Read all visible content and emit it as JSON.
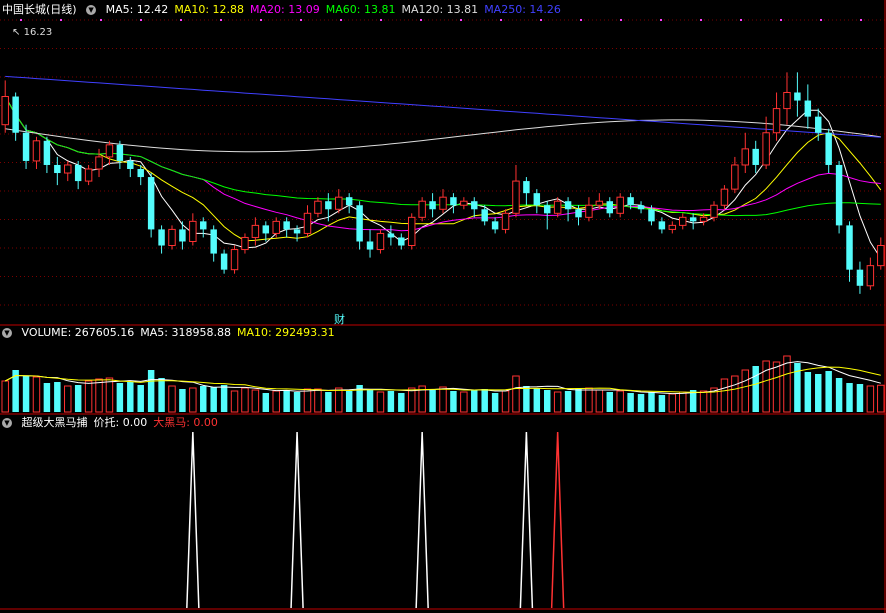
{
  "price_panel": {
    "title": "中国长城(日线)",
    "ma_labels": [
      {
        "text": "MA5: 12.42",
        "color": "#ffffff"
      },
      {
        "text": "MA10: 12.88",
        "color": "#ffff00"
      },
      {
        "text": "MA20: 13.09",
        "color": "#ff00ff"
      },
      {
        "text": "MA60: 13.81",
        "color": "#00ff00"
      },
      {
        "text": "MA120: 13.81",
        "color": "#dddddd"
      },
      {
        "text": "MA250: 14.26",
        "color": "#4040ff"
      }
    ],
    "high_marker": "16.23",
    "finance_marker": "财",
    "colors": {
      "up": "#ff3232",
      "down": "#54fcfc"
    }
  },
  "volume_panel": {
    "labels": [
      {
        "text": "VOLUME: 267605.16",
        "color": "#ffffff"
      },
      {
        "text": "MA5: 318958.88",
        "color": "#ffffff"
      },
      {
        "text": "MA10: 292493.31",
        "color": "#ffff00"
      }
    ]
  },
  "indicator_panel": {
    "labels": [
      {
        "text": "超级大黑马捕",
        "color": "#ffffff"
      },
      {
        "text": "价托: 0.00",
        "color": "#ffffff"
      },
      {
        "text": "大黑马: 0.00",
        "color": "#ff3232"
      }
    ]
  },
  "chart_data": {
    "type": "candlestick",
    "price_range": [
      9.4,
      16.8
    ],
    "candles": [
      [
        14.2,
        14.9,
        14.0,
        15.3
      ],
      [
        14.9,
        14.0,
        13.8,
        15.0
      ],
      [
        14.0,
        13.3,
        13.1,
        14.2
      ],
      [
        13.3,
        13.8,
        13.1,
        13.9
      ],
      [
        13.8,
        13.2,
        13.0,
        13.9
      ],
      [
        13.2,
        13.0,
        12.7,
        13.4
      ],
      [
        13.0,
        13.2,
        12.8,
        13.3
      ],
      [
        13.2,
        12.8,
        12.6,
        13.3
      ],
      [
        12.8,
        13.1,
        12.7,
        13.2
      ],
      [
        13.1,
        13.4,
        12.9,
        13.6
      ],
      [
        13.4,
        13.7,
        13.2,
        13.8
      ],
      [
        13.7,
        13.3,
        13.1,
        13.8
      ],
      [
        13.3,
        13.1,
        12.9,
        13.4
      ],
      [
        13.1,
        12.9,
        12.7,
        13.2
      ],
      [
        12.9,
        11.6,
        11.4,
        13.0
      ],
      [
        11.6,
        11.2,
        11.0,
        11.7
      ],
      [
        11.2,
        11.6,
        11.1,
        11.7
      ],
      [
        11.6,
        11.3,
        11.1,
        11.8
      ],
      [
        11.3,
        11.8,
        11.2,
        12.0
      ],
      [
        11.8,
        11.6,
        11.4,
        11.9
      ],
      [
        11.6,
        11.0,
        10.8,
        11.7
      ],
      [
        11.0,
        10.6,
        10.5,
        11.1
      ],
      [
        10.6,
        11.1,
        10.5,
        11.2
      ],
      [
        11.1,
        11.4,
        11.0,
        11.5
      ],
      [
        11.4,
        11.7,
        11.2,
        11.9
      ],
      [
        11.7,
        11.5,
        11.3,
        11.8
      ],
      [
        11.5,
        11.8,
        11.4,
        11.9
      ],
      [
        11.8,
        11.6,
        11.4,
        11.9
      ],
      [
        11.6,
        11.5,
        11.3,
        11.7
      ],
      [
        11.5,
        12.0,
        11.4,
        12.2
      ],
      [
        12.0,
        12.3,
        11.9,
        12.4
      ],
      [
        12.3,
        12.1,
        11.8,
        12.5
      ],
      [
        12.1,
        12.4,
        12.0,
        12.6
      ],
      [
        12.4,
        12.2,
        12.0,
        12.5
      ],
      [
        12.2,
        11.3,
        11.1,
        12.3
      ],
      [
        11.3,
        11.1,
        10.9,
        11.6
      ],
      [
        11.1,
        11.5,
        11.0,
        11.6
      ],
      [
        11.5,
        11.4,
        11.2,
        11.7
      ],
      [
        11.4,
        11.2,
        11.1,
        11.5
      ],
      [
        11.2,
        11.9,
        11.1,
        12.0
      ],
      [
        11.9,
        12.3,
        11.8,
        12.4
      ],
      [
        12.3,
        12.1,
        11.9,
        12.5
      ],
      [
        12.1,
        12.4,
        12.0,
        12.6
      ],
      [
        12.4,
        12.2,
        12.0,
        12.5
      ],
      [
        12.2,
        12.3,
        12.1,
        12.4
      ],
      [
        12.3,
        12.1,
        11.9,
        12.4
      ],
      [
        12.1,
        11.8,
        11.7,
        12.2
      ],
      [
        11.8,
        11.6,
        11.5,
        11.9
      ],
      [
        11.6,
        12.0,
        11.5,
        12.1
      ],
      [
        12.0,
        12.8,
        11.9,
        13.2
      ],
      [
        12.8,
        12.5,
        12.2,
        12.9
      ],
      [
        12.5,
        12.2,
        12.0,
        12.6
      ],
      [
        12.2,
        12.0,
        11.6,
        12.3
      ],
      [
        12.0,
        12.3,
        11.9,
        12.4
      ],
      [
        12.3,
        12.1,
        11.8,
        12.4
      ],
      [
        12.1,
        11.9,
        11.7,
        12.2
      ],
      [
        11.9,
        12.2,
        11.8,
        12.4
      ],
      [
        12.2,
        12.3,
        12.1,
        12.5
      ],
      [
        12.3,
        12.0,
        11.9,
        12.4
      ],
      [
        12.0,
        12.4,
        11.9,
        12.5
      ],
      [
        12.4,
        12.2,
        12.1,
        12.5
      ],
      [
        12.2,
        12.1,
        12.0,
        12.3
      ],
      [
        12.1,
        11.8,
        11.7,
        12.2
      ],
      [
        11.8,
        11.6,
        11.5,
        11.9
      ],
      [
        11.6,
        11.7,
        11.5,
        11.8
      ],
      [
        11.7,
        11.9,
        11.6,
        12.0
      ],
      [
        11.9,
        11.8,
        11.6,
        12.0
      ],
      [
        11.8,
        11.9,
        11.7,
        12.0
      ],
      [
        11.9,
        12.2,
        11.8,
        12.3
      ],
      [
        12.2,
        12.6,
        12.1,
        12.7
      ],
      [
        12.6,
        13.2,
        12.5,
        13.4
      ],
      [
        13.2,
        13.6,
        13.0,
        14.0
      ],
      [
        13.6,
        13.2,
        13.0,
        13.8
      ],
      [
        13.2,
        14.0,
        13.1,
        14.4
      ],
      [
        14.0,
        14.6,
        13.8,
        15.0
      ],
      [
        14.6,
        15.0,
        14.2,
        15.5
      ],
      [
        15.0,
        14.8,
        14.4,
        15.5
      ],
      [
        14.8,
        14.4,
        14.1,
        15.2
      ],
      [
        14.4,
        14.0,
        13.8,
        14.6
      ],
      [
        14.0,
        13.2,
        13.0,
        14.1
      ],
      [
        13.2,
        11.7,
        11.5,
        13.3
      ],
      [
        11.7,
        10.6,
        10.3,
        11.8
      ],
      [
        10.6,
        10.2,
        10.0,
        10.8
      ],
      [
        10.2,
        10.7,
        10.1,
        10.9
      ],
      [
        10.7,
        11.2,
        10.6,
        11.4
      ]
    ],
    "volume_range": [
      0,
      700000
    ],
    "volumes": [
      310000,
      420000,
      360000,
      350000,
      290000,
      300000,
      260000,
      270000,
      310000,
      330000,
      340000,
      290000,
      300000,
      270000,
      420000,
      340000,
      260000,
      230000,
      240000,
      260000,
      250000,
      270000,
      210000,
      240000,
      220000,
      190000,
      210000,
      220000,
      200000,
      230000,
      230000,
      200000,
      240000,
      210000,
      270000,
      220000,
      200000,
      210000,
      190000,
      240000,
      260000,
      220000,
      250000,
      210000,
      200000,
      220000,
      230000,
      190000,
      210000,
      360000,
      260000,
      240000,
      220000,
      200000,
      210000,
      230000,
      240000,
      220000,
      200000,
      210000,
      190000,
      180000,
      200000,
      170000,
      180000,
      200000,
      220000,
      210000,
      240000,
      330000,
      360000,
      420000,
      460000,
      510000,
      500000,
      560000,
      490000,
      400000,
      380000,
      410000,
      340000,
      290000,
      280000,
      260000,
      267605
    ],
    "signal_spikes": [
      {
        "bar": 18,
        "value": 1,
        "color": "#ffffff"
      },
      {
        "bar": 28,
        "value": 1,
        "color": "#ffffff"
      },
      {
        "bar": 40,
        "value": 1,
        "color": "#ffffff"
      },
      {
        "bar": 50,
        "value": 1,
        "color": "#ffffff"
      },
      {
        "bar": 53,
        "value": 1,
        "color": "#ff3232"
      }
    ]
  }
}
